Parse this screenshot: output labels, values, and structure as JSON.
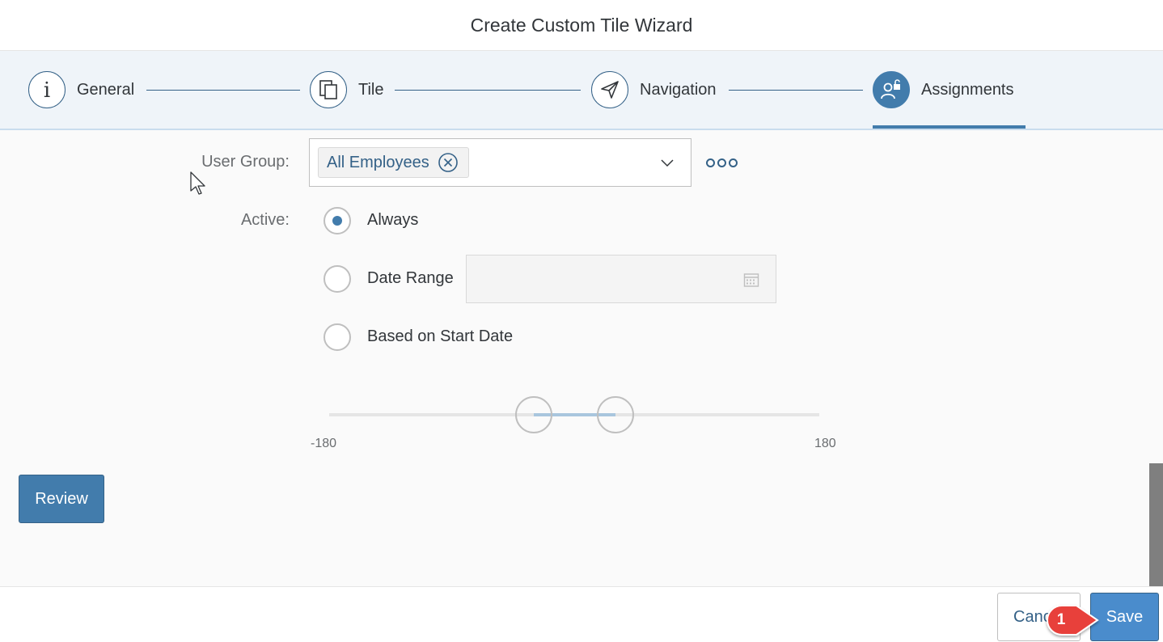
{
  "window": {
    "title": "Create Custom Tile Wizard"
  },
  "steps": [
    {
      "label": "General",
      "icon": "info-icon"
    },
    {
      "label": "Tile",
      "icon": "copy-icon"
    },
    {
      "label": "Navigation",
      "icon": "paper-plane-icon"
    },
    {
      "label": "Assignments",
      "icon": "user-unlock-icon",
      "active": true
    }
  ],
  "form": {
    "user_group_label": "User Group:",
    "user_group_token": "All Employees",
    "active_label": "Active:",
    "options": [
      {
        "label": "Always",
        "selected": true
      },
      {
        "label": "Date Range",
        "selected": false
      },
      {
        "label": "Based on Start Date",
        "selected": false
      }
    ],
    "date_range_value": "",
    "slider": {
      "min_label": "-180",
      "max_label": "180"
    }
  },
  "buttons": {
    "review": "Review",
    "cancel": "Canc",
    "save": "Save"
  },
  "callout": {
    "number": "1"
  },
  "colors": {
    "accent": "#427cac",
    "save": "#4a8ccc",
    "callout": "#e8403a"
  }
}
